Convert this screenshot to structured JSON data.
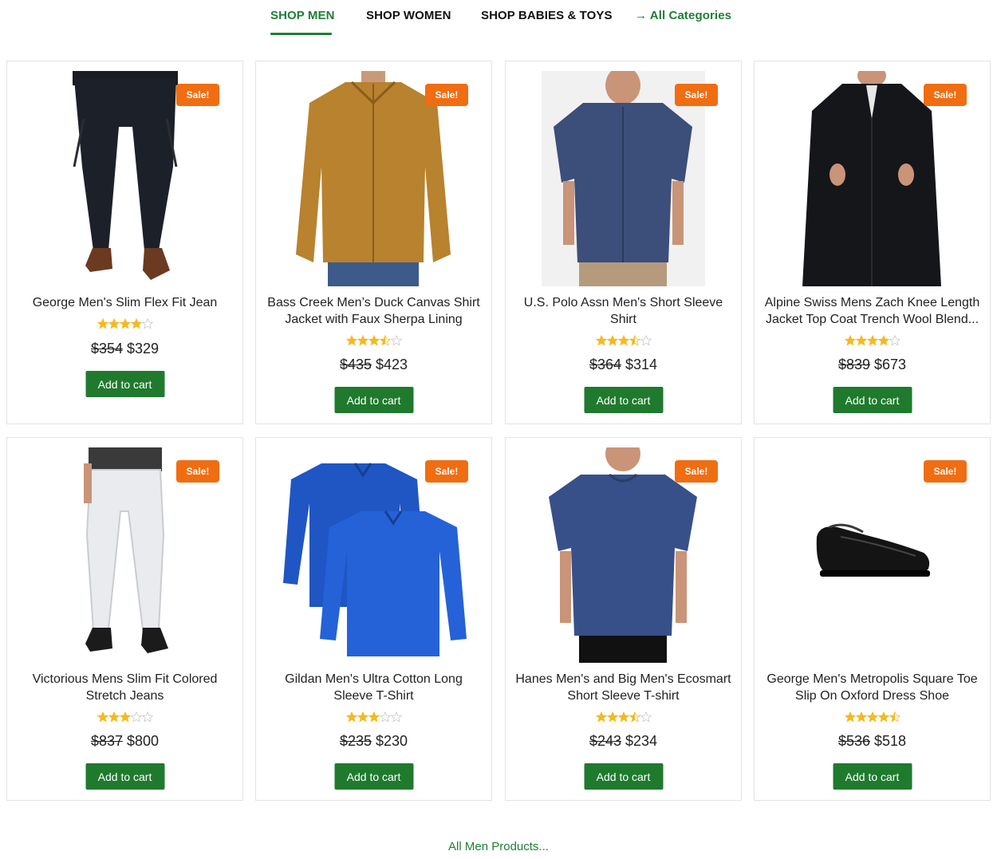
{
  "tabs": [
    {
      "label": "SHOP MEN",
      "active": true
    },
    {
      "label": "SHOP WOMEN",
      "active": false
    },
    {
      "label": "SHOP BABIES & TOYS",
      "active": false
    },
    {
      "label": "→ All Categories",
      "active": false
    }
  ],
  "colors": {
    "accent": "#1e7e34",
    "sale": "#f06d12",
    "button": "#1f7a2e",
    "star": "#f5b921"
  },
  "products": [
    {
      "title": "George Men's Slim Flex Fit Jean",
      "badge": "Sale!",
      "rating": 4,
      "old_price": "$354",
      "price": "$329",
      "cta": "Add to cart",
      "image": "dark-jeans"
    },
    {
      "title": "Bass Creek Men’s Duck Canvas Shirt Jacket with Faux Sherpa Lining",
      "badge": "Sale!",
      "rating": 3.5,
      "old_price": "$435",
      "price": "$423",
      "cta": "Add to cart",
      "image": "tan-shirt-jacket"
    },
    {
      "title": "U.S. Polo Assn Men's Short Sleeve Shirt",
      "badge": "Sale!",
      "rating": 3.5,
      "old_price": "$364",
      "price": "$314",
      "cta": "Add to cart",
      "image": "navy-short-sleeve-shirt"
    },
    {
      "title": "Alpine Swiss Mens Zach Knee Length Jacket Top Coat Trench Wool Blend...",
      "badge": "Sale!",
      "rating": 4,
      "old_price": "$839",
      "price": "$673",
      "cta": "Add to cart",
      "image": "black-trench-coat"
    },
    {
      "title": "Victorious Mens Slim Fit Colored Stretch Jeans",
      "badge": "Sale!",
      "rating": 3,
      "old_price": "$837",
      "price": "$800",
      "cta": "Add to cart",
      "image": "white-jeans"
    },
    {
      "title": "Gildan Men's Ultra Cotton Long Sleeve T-Shirt",
      "badge": "Sale!",
      "rating": 3,
      "old_price": "$235",
      "price": "$230",
      "cta": "Add to cart",
      "image": "blue-long-sleeve-tees"
    },
    {
      "title": "Hanes Men's and Big Men's Ecosmart Short Sleeve T-shirt",
      "badge": "Sale!",
      "rating": 3.5,
      "old_price": "$243",
      "price": "$234",
      "cta": "Add to cart",
      "image": "navy-tshirt"
    },
    {
      "title": "George Men's Metropolis Square Toe Slip On Oxford Dress Shoe",
      "badge": "Sale!",
      "rating": 4.5,
      "old_price": "$536",
      "price": "$518",
      "cta": "Add to cart",
      "image": "black-dress-shoe"
    }
  ],
  "footer": {
    "link_label": "All Men Products..."
  }
}
